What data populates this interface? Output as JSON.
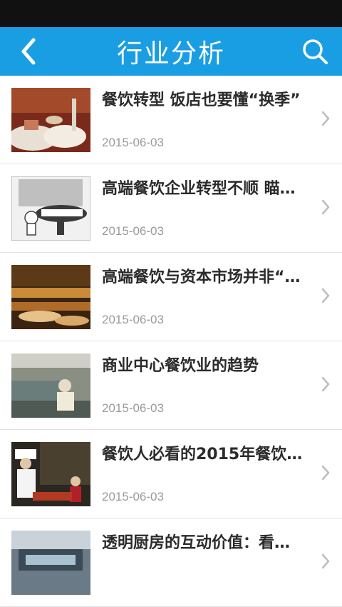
{
  "header": {
    "title": "行业分析",
    "back_icon": "chevron-left-icon",
    "search_icon": "search-icon",
    "color": "#1a9ee3"
  },
  "articles": [
    {
      "title": "餐饮转型 饭店也要懂“换季”",
      "date": "2015-06-03"
    },
    {
      "title": "高端餐饮企业转型不顺 瞄…",
      "date": "2015-06-03"
    },
    {
      "title": "高端餐饮与资本市场并非“…",
      "date": "2015-06-03"
    },
    {
      "title": "商业中心餐饮业的趋势",
      "date": "2015-06-03"
    },
    {
      "title": "餐饮人必看的2015年餐饮…",
      "date": "2015-06-03"
    },
    {
      "title": "透明厨房的互动价值：看…",
      "date": ""
    }
  ]
}
